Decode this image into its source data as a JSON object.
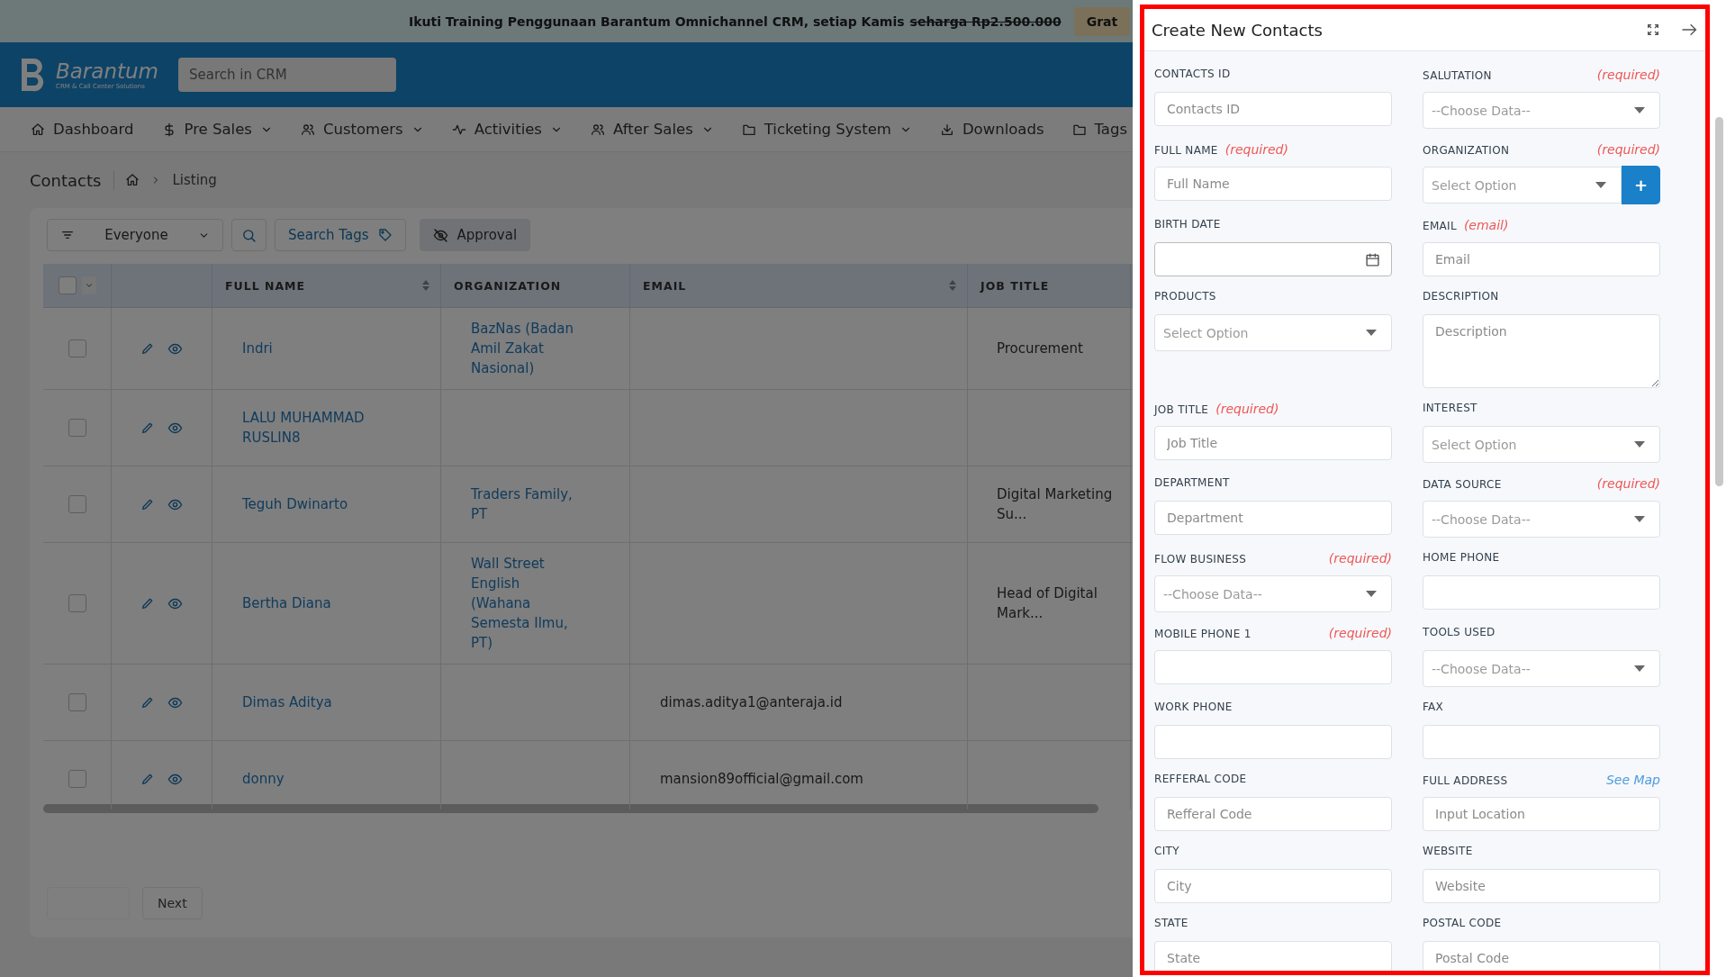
{
  "banner": {
    "text": "Ikuti Training Penggunaan Barantum Omnichannel CRM, setiap Kamis",
    "strike_text": "seharga Rp2.500.000",
    "button": "Grat"
  },
  "header": {
    "brand": "Barantum",
    "tagline": "CRM & Call Center Solutions",
    "search_placeholder": "Search in CRM"
  },
  "nav": [
    {
      "label": "Dashboard",
      "has_menu": false
    },
    {
      "label": "Pre Sales",
      "has_menu": true
    },
    {
      "label": "Customers",
      "has_menu": true
    },
    {
      "label": "Activities",
      "has_menu": true
    },
    {
      "label": "After Sales",
      "has_menu": true
    },
    {
      "label": "Ticketing System",
      "has_menu": true
    },
    {
      "label": "Downloads",
      "has_menu": false
    },
    {
      "label": "Tags",
      "has_menu": false
    }
  ],
  "breadcrumb": {
    "title": "Contacts",
    "current": "Listing"
  },
  "toolbar": {
    "filter": "Everyone",
    "search_tags": "Search Tags",
    "approval": "Approval"
  },
  "table": {
    "all_selected": false,
    "columns": [
      {
        "label": "FULL NAME",
        "sortable": true
      },
      {
        "label": "ORGANIZATION",
        "sortable": false
      },
      {
        "label": "EMAIL",
        "sortable": true
      },
      {
        "label": "JOB TITLE",
        "sortable": false
      }
    ],
    "rows": [
      {
        "selected": false,
        "full_name": "Indri",
        "organization": "BazNas (Badan Amil Zakat Nasional)",
        "job_title": "Procurement"
      },
      {
        "selected": false,
        "full_name": "LALU MUHAMMAD RUSLIN8"
      },
      {
        "selected": false,
        "full_name": "Teguh Dwinarto",
        "organization": "Traders Family, PT",
        "job_title": "Digital Marketing Su..."
      },
      {
        "selected": false,
        "full_name": "Bertha Diana",
        "organization": "Wall Street English (Wahana Semesta Ilmu, PT)",
        "job_title": "Head of Digital Mark..."
      },
      {
        "selected": false,
        "full_name": "Dimas Aditya",
        "email": "dimas.aditya1@anteraja.id"
      },
      {
        "selected": false,
        "full_name": "donny",
        "email": "mansion89official@gmail.com"
      }
    ]
  },
  "pagination": {
    "next": "Next"
  },
  "panel": {
    "title": "Create New Contacts",
    "fields": [
      {
        "label": "CONTACTS ID",
        "kind": "text",
        "placeholder": "Contacts ID"
      },
      {
        "label": "SALUTATION",
        "hint": "(required)",
        "hint_inline": false,
        "kind": "select",
        "placeholder": "--Choose Data--"
      },
      {
        "label": "FULL NAME",
        "hint": "(required)",
        "hint_inline": true,
        "kind": "text",
        "placeholder": "Full Name"
      },
      {
        "label": "ORGANIZATION",
        "hint": "(required)",
        "hint_inline": false,
        "kind": "select_add",
        "placeholder": "Select Option",
        "add_button": "+"
      },
      {
        "label": "BIRTH DATE",
        "kind": "date"
      },
      {
        "label": "EMAIL",
        "hint": "(email)",
        "hint_inline": true,
        "kind": "text",
        "placeholder": "Email"
      },
      {
        "label": "PRODUCTS",
        "kind": "select",
        "placeholder": "Select Option"
      },
      {
        "label": "DESCRIPTION",
        "kind": "textarea",
        "placeholder": "Description"
      },
      {
        "label": "JOB TITLE",
        "hint": "(required)",
        "hint_inline": true,
        "kind": "text",
        "placeholder": "Job Title"
      },
      {
        "label": "INTEREST",
        "kind": "select",
        "placeholder": "Select Option"
      },
      {
        "label": "DEPARTMENT",
        "kind": "text",
        "placeholder": "Department"
      },
      {
        "label": "DATA SOURCE",
        "hint": "(required)",
        "hint_inline": false,
        "kind": "select",
        "placeholder": "--Choose Data--"
      },
      {
        "label": "FLOW BUSINESS",
        "hint": "(required)",
        "hint_inline": false,
        "kind": "select",
        "placeholder": "--Choose Data--"
      },
      {
        "label": "HOME PHONE",
        "kind": "text"
      },
      {
        "label": "MOBILE PHONE 1",
        "hint": "(required)",
        "hint_inline": false,
        "kind": "text"
      },
      {
        "label": "TOOLS USED",
        "kind": "select",
        "placeholder": "--Choose Data--"
      },
      {
        "label": "WORK PHONE",
        "kind": "text"
      },
      {
        "label": "FAX",
        "kind": "text"
      },
      {
        "label": "REFFERAL CODE",
        "kind": "text",
        "placeholder": "Refferal Code"
      },
      {
        "label": "FULL ADDRESS",
        "link": "See Map",
        "kind": "text",
        "placeholder": "Input Location"
      },
      {
        "label": "CITY",
        "kind": "text",
        "placeholder": "City"
      },
      {
        "label": "WEBSITE",
        "kind": "text",
        "placeholder": "Website"
      },
      {
        "label": "STATE",
        "kind": "text",
        "placeholder": "State"
      },
      {
        "label": "POSTAL CODE",
        "kind": "text",
        "placeholder": "Postal Code"
      }
    ]
  }
}
